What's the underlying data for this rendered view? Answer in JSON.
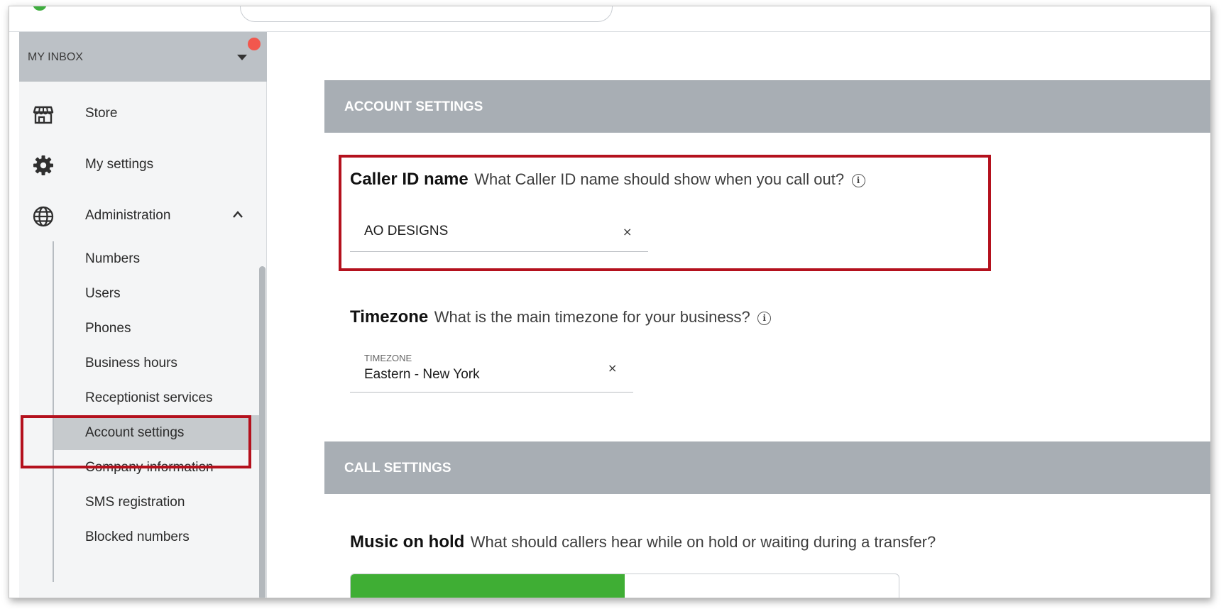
{
  "topbar": {},
  "sidebar": {
    "inbox_label": "MY INBOX",
    "main_items": [
      {
        "label": "Store",
        "icon": "store-icon"
      },
      {
        "label": "My settings",
        "icon": "gear-icon"
      },
      {
        "label": "Administration",
        "icon": "globe-icon",
        "expanded": true
      }
    ],
    "sub_items": [
      {
        "label": "Numbers"
      },
      {
        "label": "Users"
      },
      {
        "label": "Phones"
      },
      {
        "label": "Business hours"
      },
      {
        "label": "Receptionist services"
      },
      {
        "label": "Account settings",
        "active": true
      },
      {
        "label": "Company information"
      },
      {
        "label": "SMS registration"
      },
      {
        "label": "Blocked numbers"
      }
    ]
  },
  "main": {
    "account_header": "ACCOUNT SETTINGS",
    "caller_id": {
      "title": "Caller ID name",
      "description": "What Caller ID name should show when you call out?",
      "value": "AO DESIGNS"
    },
    "timezone": {
      "title": "Timezone",
      "description": "What is the main timezone for your business?",
      "field_label": "TIMEZONE",
      "value": "Eastern - New York"
    },
    "call_header": "CALL SETTINGS",
    "music_on_hold": {
      "title": "Music on hold",
      "description": "What should callers hear while on hold or waiting during a transfer?",
      "fill_fraction": 0.5
    }
  },
  "colors": {
    "accent_green": "#3fae34",
    "highlight_red": "#b4111d",
    "section_header": "#a8aeb4",
    "notification": "#f2574d"
  },
  "glyphs": {
    "info": "i",
    "clear": "×"
  }
}
